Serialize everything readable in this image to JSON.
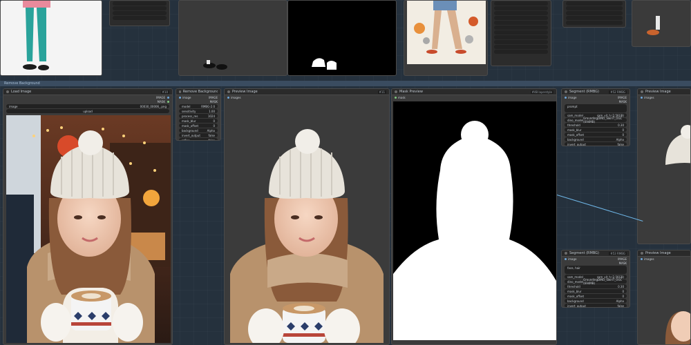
{
  "group": {
    "label": "Remove Background"
  },
  "top_nodes": {
    "small_panel_rows": [
      "",
      "",
      "",
      "",
      "",
      ""
    ],
    "right_panel_rows": [
      "",
      "",
      "",
      "",
      "",
      "",
      "",
      "",
      "",
      "",
      ""
    ],
    "far_right_rows": [
      "",
      "",
      "",
      "",
      ""
    ]
  },
  "load_image": {
    "title": "Load Image",
    "badge": "#10",
    "outputs": [
      "IMAGE",
      "MASK"
    ],
    "image_field": "image",
    "image_value": "00030_00006_.png",
    "upload_label": "upload"
  },
  "remove_bg": {
    "title": "Remove Background (RMBG)",
    "badge": "#45",
    "input": "image",
    "outputs": [
      "IMAGE",
      "MASK"
    ],
    "widgets": [
      {
        "label": "model",
        "value": "RMBG-2.0"
      },
      {
        "label": "sensitivity",
        "value": "1.00"
      },
      {
        "label": "process_res",
        "value": "1024"
      },
      {
        "label": "mask_blur",
        "value": "0"
      },
      {
        "label": "mask_offset",
        "value": "0"
      },
      {
        "label": "background",
        "value": "Alpha"
      },
      {
        "label": "invert_output",
        "value": "false"
      },
      {
        "label": "refine",
        "value": "false"
      }
    ]
  },
  "preview_image": {
    "title": "Preview Image",
    "badge": "#11",
    "input": "images"
  },
  "mask_preview": {
    "title": "Mask Preview",
    "badge": "#48 layerstyle",
    "input": "mask"
  },
  "segment_top": {
    "title": "Segment (RMBG)",
    "badge": "#52 RMBG",
    "input": "image",
    "outputs": [
      "IMAGE",
      "MASK"
    ],
    "prompt_label": "prompt",
    "widgets": [
      {
        "label": "sam_model",
        "value": "sam_vit_h (2.56GB)"
      },
      {
        "label": "dino_model",
        "value": "GroundingDINO_SwinT_OGC (694MB)"
      },
      {
        "label": "threshold",
        "value": "0.30"
      },
      {
        "label": "mask_blur",
        "value": "0"
      },
      {
        "label": "mask_offset",
        "value": "0"
      },
      {
        "label": "background",
        "value": "Alpha"
      },
      {
        "label": "invert_output",
        "value": "false"
      }
    ]
  },
  "segment_bottom": {
    "title": "Segment (RMBG)",
    "badge": "#53 RMBG",
    "input": "image",
    "outputs": [
      "IMAGE",
      "MASK"
    ],
    "prompt_label": "face, hair",
    "widgets": [
      {
        "label": "sam_model",
        "value": "sam_vit_h (2.56GB)"
      },
      {
        "label": "dino_model",
        "value": "GroundingDINO_SwinT_OGC (694MB)"
      },
      {
        "label": "threshold",
        "value": "0.30"
      },
      {
        "label": "mask_blur",
        "value": "0"
      },
      {
        "label": "mask_offset",
        "value": "0"
      },
      {
        "label": "background",
        "value": "Alpha"
      },
      {
        "label": "invert_output",
        "value": "false"
      }
    ]
  },
  "preview_right_top": {
    "title": "Preview Image",
    "input": "images"
  },
  "preview_right_bottom": {
    "title": "Preview Image",
    "input": "images"
  }
}
